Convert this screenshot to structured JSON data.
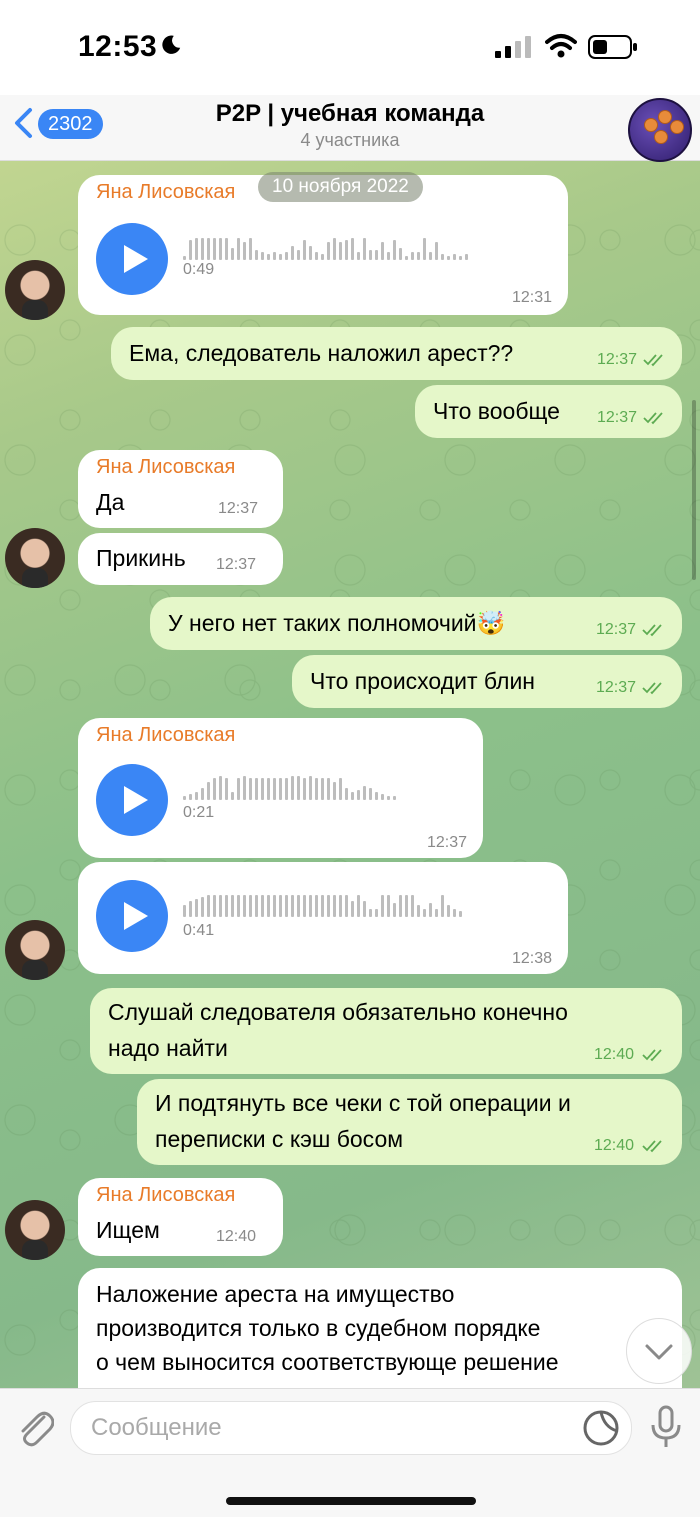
{
  "status": {
    "time": "12:53"
  },
  "header": {
    "back_count": "2302",
    "title": "P2P | учебная команда",
    "subtitle": "4 участника"
  },
  "date_pill": "10 ноября 2022",
  "messages": [
    {
      "sender": "Яна Лисовская",
      "type": "voice",
      "duration": "0:49",
      "time": "12:31"
    },
    {
      "type": "text",
      "out": true,
      "text": "Ема, следователь наложил арест??",
      "time": "12:37"
    },
    {
      "type": "text",
      "out": true,
      "text": "Что вообще",
      "time": "12:37"
    },
    {
      "sender": "Яна Лисовская",
      "type": "text",
      "text": "Да",
      "time": "12:37"
    },
    {
      "type": "text",
      "text": "Прикинь",
      "time": "12:37"
    },
    {
      "type": "text",
      "out": true,
      "text": "У него нет таких полномочий🤯",
      "time": "12:37"
    },
    {
      "type": "text",
      "out": true,
      "text": "Что происходит блин",
      "time": "12:37"
    },
    {
      "sender": "Яна Лисовская",
      "type": "voice",
      "duration": "0:21",
      "time": "12:37"
    },
    {
      "type": "voice",
      "duration": "0:41",
      "time": "12:38"
    },
    {
      "type": "text",
      "out": true,
      "line1": "Слушай следователя обязательно конечно",
      "line2": "надо найти",
      "time": "12:40"
    },
    {
      "type": "text",
      "out": true,
      "line1": "И подтянуть все чеки с той операции и",
      "line2": "переписки с кэш босом",
      "time": "12:40"
    },
    {
      "sender": "Яна Лисовская",
      "type": "text",
      "text": "Ищем",
      "time": "12:40"
    },
    {
      "type": "text",
      "line1": "Наложение ареста на имущество",
      "line2": "производится только в судебном порядке",
      "line3": "о чем выносится соответствующе решение"
    }
  ],
  "input": {
    "placeholder": "Сообщение"
  },
  "colors": {
    "accent": "#3a86f5",
    "sender": "#e87b29",
    "outgoing": "#e5f7c9",
    "ticks": "#5dab52"
  },
  "icons": [
    "moon-icon",
    "signal-icon",
    "wifi-icon",
    "battery-icon",
    "back-chevron-icon",
    "play-icon",
    "read-ticks-icon",
    "chevron-down-icon",
    "paperclip-icon",
    "sticker-icon",
    "mic-icon"
  ]
}
